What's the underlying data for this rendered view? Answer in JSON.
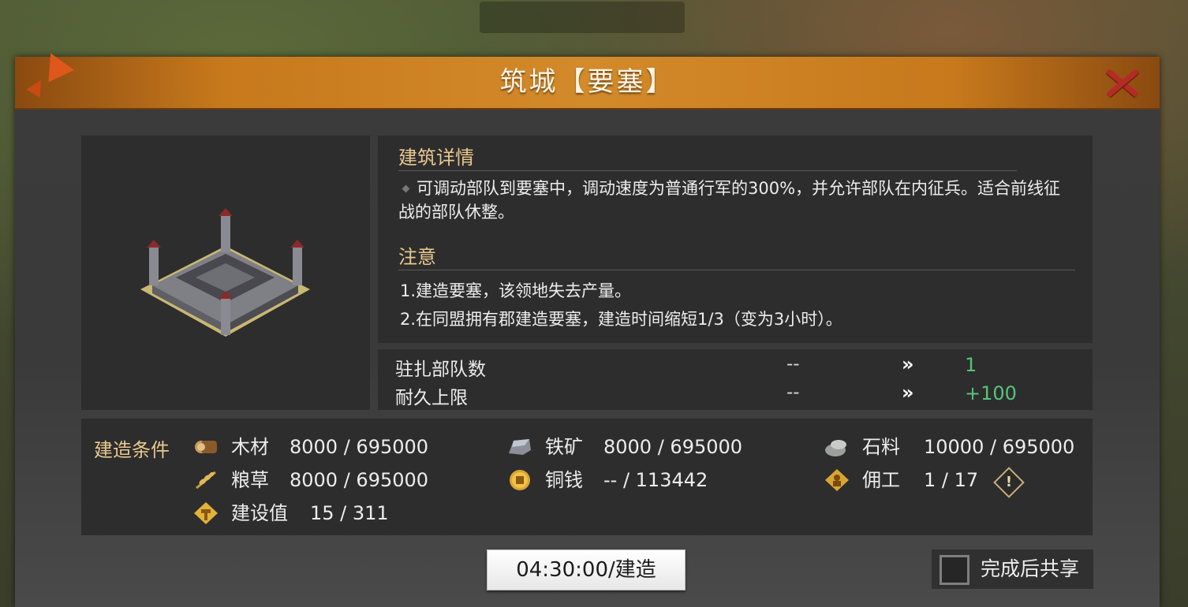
{
  "dialog": {
    "title": "筑城【要塞】"
  },
  "details": {
    "section_title": "建筑详情",
    "description": "可调动部队到要塞中，调动速度为普通行军的300%，并允许部队在内征兵。适合前线征战的部队休整。",
    "notes_title": "注意",
    "notes": [
      "1.建造要塞，该领地失去产量。",
      "2.在同盟拥有郡建造要塞，建造时间缩短1/3（变为3小时）。"
    ]
  },
  "stats": [
    {
      "label": "驻扎部队数",
      "from": "--",
      "arrow": "»",
      "to": "1"
    },
    {
      "label": "耐久上限",
      "from": "--",
      "arrow": "»",
      "to": "+100"
    }
  ],
  "costs": {
    "title": "建造条件",
    "items": [
      {
        "icon": "wood-icon",
        "name": "木材",
        "value": "8000 / 695000"
      },
      {
        "icon": "iron-ore-icon",
        "name": "铁矿",
        "value": "8000 / 695000"
      },
      {
        "icon": "stone-icon",
        "name": "石料",
        "value": "10000 / 695000"
      },
      {
        "icon": "grain-icon",
        "name": "粮草",
        "value": "8000 / 695000"
      },
      {
        "icon": "copper-coin-icon",
        "name": "铜钱",
        "value": "-- / 113442"
      },
      {
        "icon": "laborer-icon",
        "name": "佣工",
        "value": "1 / 17"
      },
      {
        "icon": "construction-value-icon",
        "name": "建设值",
        "value": "15 / 311"
      }
    ],
    "warning_glyph": "!"
  },
  "actions": {
    "build_label": "04:30:00/建造",
    "share_label": "完成后共享",
    "share_checked": false
  },
  "colors": {
    "title_bar": "#c7791c",
    "section_title": "#e9c98f",
    "stat_increase": "#56c47a",
    "close_x": "#b52b25"
  }
}
